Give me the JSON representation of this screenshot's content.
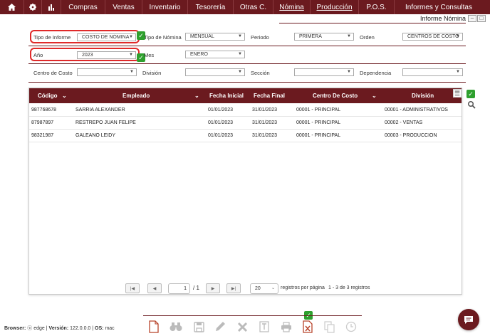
{
  "nav": {
    "items": [
      "Compras",
      "Ventas",
      "Inventario",
      "Tesorería",
      "Otras C.",
      "Nómina",
      "Producción",
      "P.O.S.",
      "Informes y Consultas"
    ]
  },
  "title": {
    "text": "Informe Nómina",
    "minimize": "–",
    "close": "□"
  },
  "filters": {
    "tipo_informe": {
      "label": "Tipo de Informe",
      "value": "COSTO DE NÓMINA"
    },
    "tipo_nomina": {
      "label": "Tipo de Nómina",
      "value": "MENSUAL"
    },
    "periodo": {
      "label": "Periodo",
      "value": "PRIMERA"
    },
    "orden": {
      "label": "Orden",
      "value": "CENTROS DE COSTO"
    },
    "anio": {
      "label": "Año",
      "value": "2023"
    },
    "mes": {
      "label": "Mes",
      "value": "ENERO"
    },
    "centro_costo": {
      "label": "Centro de Costo",
      "value": ""
    },
    "division": {
      "label": "División",
      "value": ""
    },
    "seccion": {
      "label": "Sección",
      "value": ""
    },
    "dependencia": {
      "label": "Dependencia",
      "value": ""
    }
  },
  "grid": {
    "columns": [
      "Código",
      "Empleado",
      "Fecha Inicial",
      "Fecha Final",
      "Centro De Costo",
      "División"
    ],
    "rows": [
      [
        "987768678",
        "SARRIA  ALEXANDER",
        "01/01/2023",
        "31/01/2023",
        "00001 - PRINCIPAL",
        "00001 - ADMINISTRATIVOS"
      ],
      [
        "87987897",
        "RESTREPO  JUAN FELIPE",
        "01/01/2023",
        "31/01/2023",
        "00001 - PRINCIPAL",
        "00002 - VENTAS"
      ],
      [
        "98321987",
        "GALEANO  LEIDY",
        "01/01/2023",
        "31/01/2023",
        "00001 - PRINCIPAL",
        "00003 - PRODUCCION"
      ]
    ]
  },
  "pager": {
    "current_page": "1",
    "total_pages": "/ 1",
    "page_size": "20",
    "per_page_label": "registros por página",
    "summary": "1 - 3 de 3 registros"
  },
  "footer": {
    "browser_label": "Browser:",
    "browser": "edge",
    "version_label": "Versión:",
    "version": "122.0.0.0",
    "os_label": "OS:",
    "os": "mac"
  },
  "colors": {
    "brand": "#6b1a1f",
    "highlight": "#e02a2a",
    "ok": "#2ea02e"
  }
}
